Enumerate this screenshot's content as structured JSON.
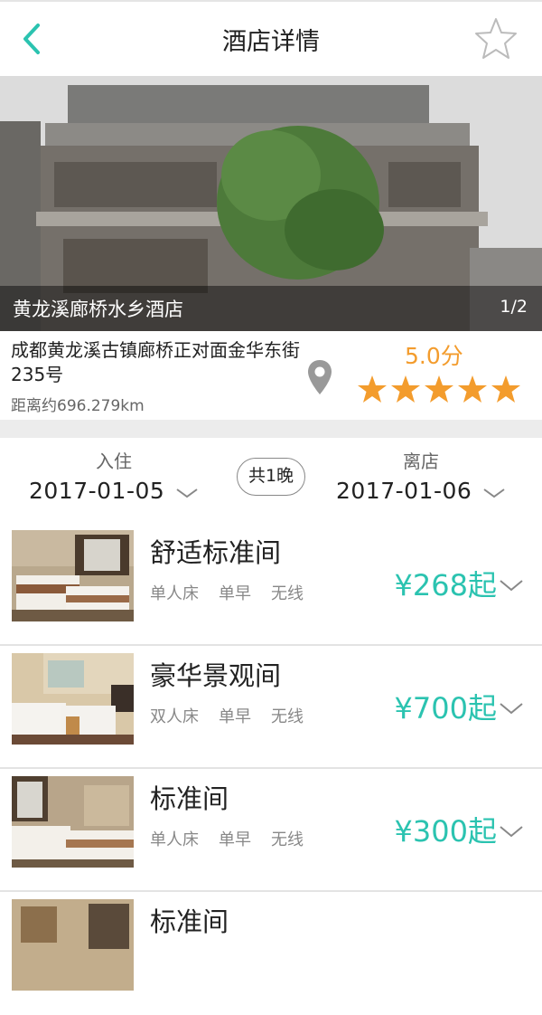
{
  "header": {
    "title": "酒店详情",
    "back_icon": "chevron-left-icon",
    "favorite_icon": "star-outline-icon"
  },
  "hero": {
    "hotel_name": "黄龙溪廊桥水乡酒店",
    "counter": "1/2"
  },
  "info": {
    "address": "成都黄龙溪古镇廊桥正对面金华东街235号",
    "distance": "距离约696.279km",
    "score": "5.0分",
    "rating_stars": 5,
    "accent_color": "#f39c2d"
  },
  "dates": {
    "checkin_label": "入住",
    "checkin_date": "2017-01-05",
    "nights": "共1晚",
    "checkout_label": "离店",
    "checkout_date": "2017-01-06"
  },
  "rooms": [
    {
      "name": "舒适标准间",
      "tags": [
        "单人床",
        "单早",
        "无线"
      ],
      "price": "¥268起"
    },
    {
      "name": "豪华景观间",
      "tags": [
        "双人床",
        "单早",
        "无线"
      ],
      "price": "¥700起"
    },
    {
      "name": "标准间",
      "tags": [
        "单人床",
        "单早",
        "无线"
      ],
      "price": "¥300起"
    },
    {
      "name": "标准间",
      "tags": [],
      "price": ""
    }
  ],
  "colors": {
    "price": "#2bc3b0",
    "back": "#2bc3b0"
  }
}
